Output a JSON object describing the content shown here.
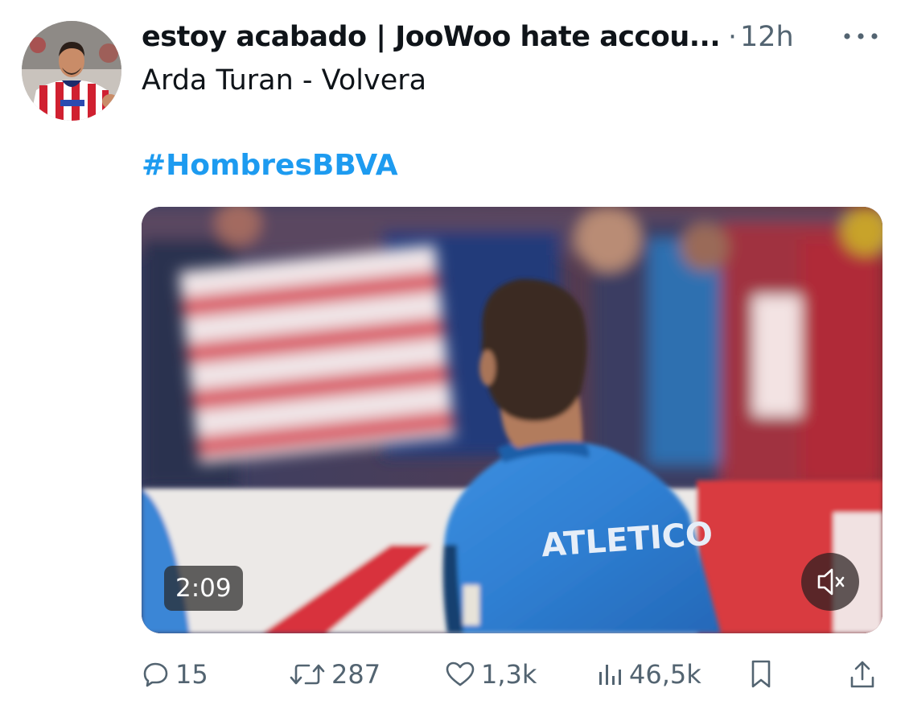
{
  "tweet": {
    "author_display": "estoy acabado | JooWoo hate accou...",
    "separator": "·",
    "time": "12h",
    "text": "Arda Turan - Volvera",
    "hashtag": "#HombresBBVA"
  },
  "media": {
    "type": "video",
    "duration": "2:09",
    "muted": true,
    "jersey_text": "ATLETICO"
  },
  "actions": {
    "replies": "15",
    "reposts": "287",
    "likes": "1,3k",
    "views": "46,5k"
  },
  "icons": {
    "more": "more-horizontal-icon",
    "reply": "reply-icon",
    "repost": "repost-icon",
    "like": "heart-icon",
    "views": "analytics-icon",
    "bookmark": "bookmark-icon",
    "share": "share-icon",
    "mute": "speaker-muted-icon"
  },
  "colors": {
    "text": "#0f1419",
    "secondary": "#536471",
    "accent": "#1d9bf0"
  }
}
